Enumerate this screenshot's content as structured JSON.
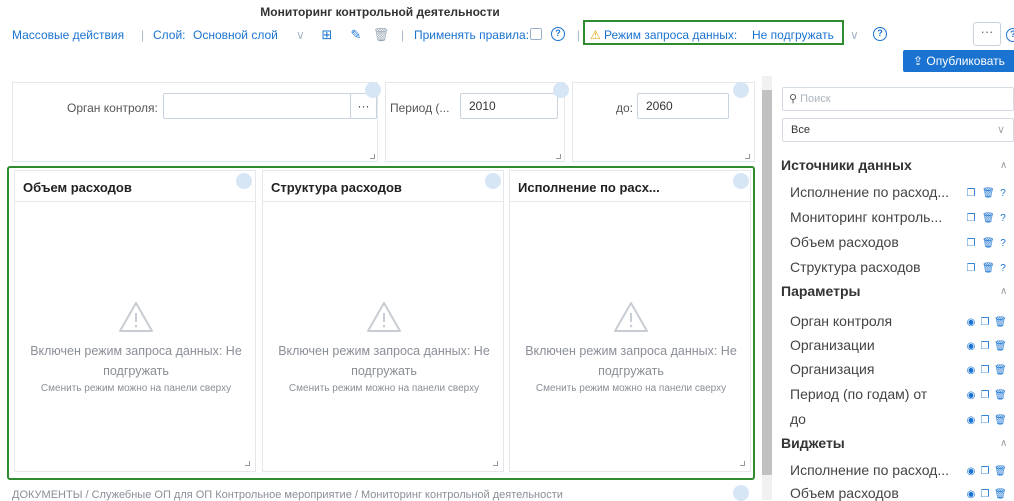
{
  "page_title": "Мониторинг контрольной деятельности",
  "toolbar": {
    "bulk_actions": "Массовые действия",
    "layer_label": "Слой:",
    "layer_value": "Основной слой",
    "apply_rules": "Применять правила:",
    "data_mode_label": "Режим запроса данных:",
    "data_mode_value": "Не подгружать",
    "more": "···",
    "publish": "Опубликовать"
  },
  "filters": {
    "org_label": "Орган контроля:",
    "org_button": "···",
    "period_label": "Период (...",
    "period_value": "2010",
    "to_label": "до:",
    "to_value": "2060"
  },
  "widgets": [
    {
      "title": "Объем расходов",
      "message": "Включен режим запроса данных: Не подгружать",
      "hint": "Сменить режим можно на панели сверху"
    },
    {
      "title": "Структура расходов",
      "message": "Включен режим запроса данных: Не подгружать",
      "hint": "Сменить режим можно на панели сверху"
    },
    {
      "title": "Исполнение по расх...",
      "message": "Включен режим запроса данных: Не подгружать",
      "hint": "Сменить режим можно на панели сверху"
    }
  ],
  "breadcrumb": "ДОКУМЕНТЫ / Служебные ОП для ОП Контрольное мероприятие / Мониторинг контрольной деятельности",
  "sidebar": {
    "search_placeholder": "Поиск",
    "select_value": "Все",
    "sections": [
      {
        "title": "Источники данных",
        "items": [
          "Исполнение по расход...",
          "Мониторинг контроль...",
          "Объем расходов",
          "Структура расходов"
        ]
      },
      {
        "title": "Параметры",
        "items": [
          "Орган контроля",
          "Организации",
          "Организация",
          "Период (по годам) от",
          "до"
        ]
      },
      {
        "title": "Виджеты",
        "items": [
          "Исполнение по расход...",
          "Объем расходов"
        ]
      }
    ]
  },
  "colors": {
    "accent": "#1a73d1",
    "highlight": "#2e8b2e"
  }
}
